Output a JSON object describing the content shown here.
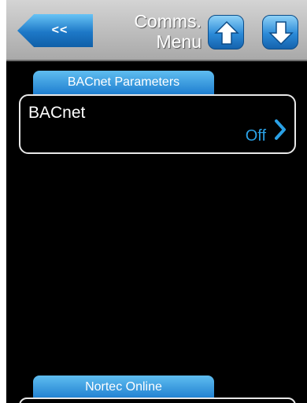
{
  "header": {
    "back_label": "<<",
    "title_line1": "Comms.",
    "title_line2": "Menu"
  },
  "sections": [
    {
      "tab_label": "BACnet Parameters",
      "items": [
        {
          "label": "BACnet",
          "value": "Off"
        }
      ]
    },
    {
      "tab_label": "Nortec Online"
    }
  ],
  "colors": {
    "accent_blue": "#1f7fd0",
    "value_blue": "#2aa1e6",
    "background": "#000000",
    "header_gray": "#bdbdbd"
  },
  "icons": {
    "back": "back-arrow-icon",
    "up": "up-arrow-icon",
    "down": "down-arrow-icon",
    "chevron": "chevron-right-icon"
  }
}
